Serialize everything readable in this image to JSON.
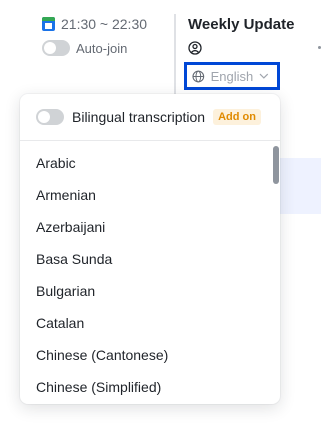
{
  "event": {
    "time": "21:30 ~ 22:30",
    "autojoin_label": "Auto-join",
    "title": "Weekly Update"
  },
  "language_select": {
    "value": "English"
  },
  "dropdown": {
    "bilingual_label": "Bilingual transcription",
    "addon_badge": "Add on",
    "languages": [
      "Arabic",
      "Armenian",
      "Azerbaijani",
      "Basa Sunda",
      "Bulgarian",
      "Catalan",
      "Chinese (Cantonese)",
      "Chinese (Simplified)"
    ]
  }
}
